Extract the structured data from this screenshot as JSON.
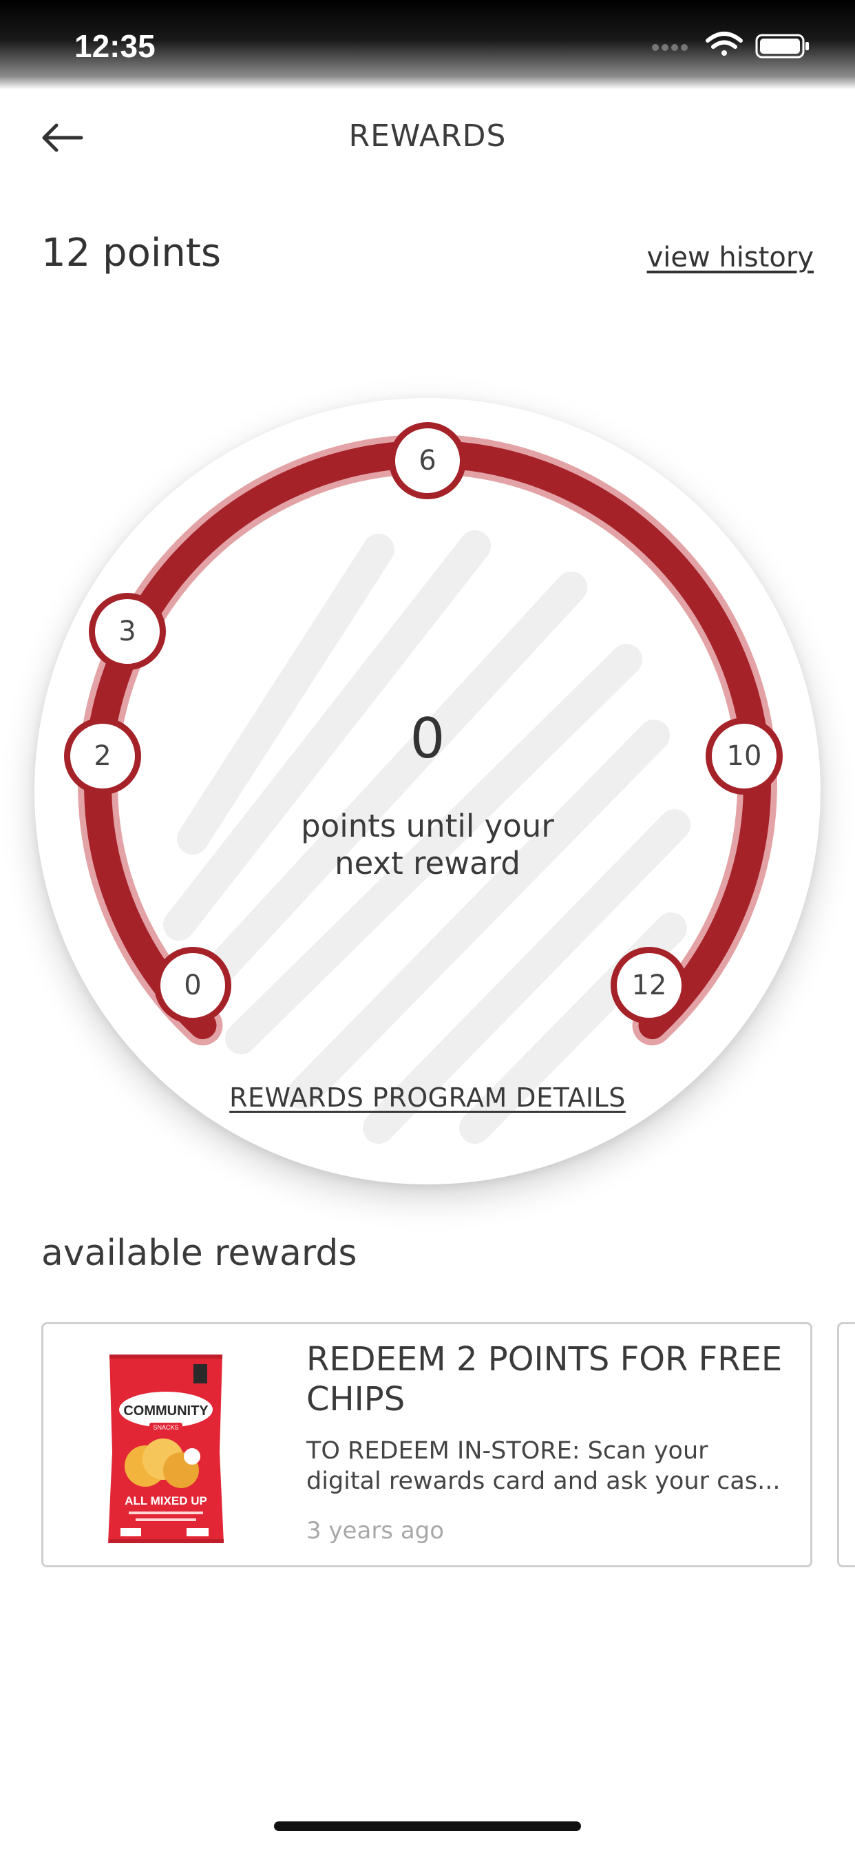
{
  "status_bar": {
    "time": "12:35"
  },
  "header": {
    "title": "REWARDS"
  },
  "points": {
    "total_label": "12 points",
    "view_history_label": "view history"
  },
  "gauge": {
    "center_value": "0",
    "center_caption": "points until your next reward",
    "program_details_label": "REWARDS PROGRAM DETAILS",
    "milestones": [
      "0",
      "2",
      "3",
      "6",
      "10",
      "12"
    ],
    "progress_fraction": 1.0,
    "accent_color": "#a52229"
  },
  "available_rewards": {
    "title": "available rewards",
    "items": [
      {
        "title": "REDEEM 2 POINTS FOR FREE CHIPS",
        "description": "TO REDEEM IN-STORE:  Scan your digital rewards card and ask your cas...",
        "time_ago": "3 years ago",
        "product_brand": "COMMUNITY",
        "product_sub": "SNACKS",
        "product_flavor": "ALL MIXED UP"
      }
    ]
  }
}
